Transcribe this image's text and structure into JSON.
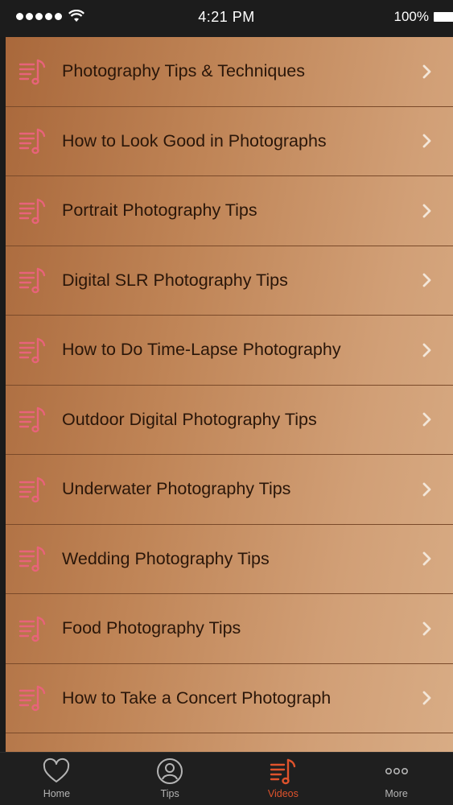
{
  "status_bar": {
    "time": "4:21 PM",
    "battery": "100%",
    "signal_icon": "signal-dots-icon",
    "wifi_icon": "wifi-icon"
  },
  "list": {
    "items": [
      {
        "label": "Photography Tips & Techniques",
        "icon": "music-list-icon"
      },
      {
        "label": "How to Look Good in Photographs",
        "icon": "music-list-icon"
      },
      {
        "label": "Portrait Photography Tips",
        "icon": "music-list-icon"
      },
      {
        "label": "Digital SLR Photography Tips",
        "icon": "music-list-icon"
      },
      {
        "label": "How to Do Time-Lapse Photography",
        "icon": "music-list-icon"
      },
      {
        "label": "Outdoor Digital Photography Tips",
        "icon": "music-list-icon"
      },
      {
        "label": "Underwater Photography Tips",
        "icon": "music-list-icon"
      },
      {
        "label": "Wedding Photography Tips",
        "icon": "music-list-icon"
      },
      {
        "label": "Food Photography Tips",
        "icon": "music-list-icon"
      },
      {
        "label": "How to Take a Concert Photograph",
        "icon": "music-list-icon"
      }
    ],
    "icon_color": "#e8637a",
    "chevron_color": "#f3e6d8"
  },
  "tab_bar": {
    "tabs": [
      {
        "label": "Home",
        "icon": "heart-icon",
        "active": false
      },
      {
        "label": "Tips",
        "icon": "user-circle-icon",
        "active": false
      },
      {
        "label": "Videos",
        "icon": "music-list-icon",
        "active": true
      },
      {
        "label": "More",
        "icon": "more-dots-icon",
        "active": false
      }
    ],
    "active_color": "#e0532c",
    "inactive_color": "#b4b4b4"
  }
}
